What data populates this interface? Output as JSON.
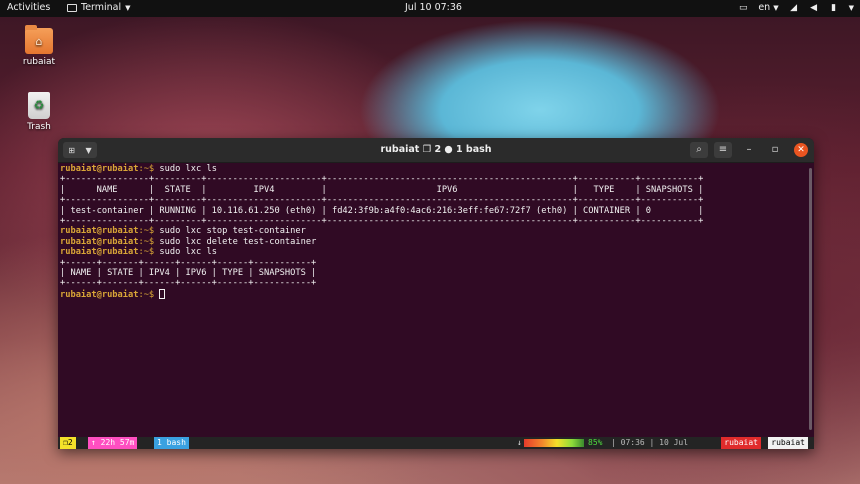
{
  "topbar": {
    "activities": "Activities",
    "app_name": "Terminal",
    "clock": "Jul 10  07:36",
    "lang": "en"
  },
  "desktop": {
    "icons": [
      {
        "label": "rubaiat"
      },
      {
        "label": "Trash"
      }
    ]
  },
  "window": {
    "title": "rubaiat ❐ 2 ● 1 bash"
  },
  "terminal": {
    "prompt_user": "rubaiat@rubaiat",
    "prompt_path": ":~$ ",
    "lines": [
      {
        "type": "prompt",
        "cmd": "sudo lxc ls"
      },
      {
        "type": "out",
        "text": "+----------------+---------+----------------------+-----------------------------------------------+-----------+-----------+"
      },
      {
        "type": "out",
        "text": "|      NAME      |  STATE  |         IPV4         |                     IPV6                      |   TYPE    | SNAPSHOTS |"
      },
      {
        "type": "out",
        "text": "+----------------+---------+----------------------+-----------------------------------------------+-----------+-----------+"
      },
      {
        "type": "out",
        "text": "| test-container | RUNNING | 10.116.61.250 (eth0) | fd42:3f9b:a4f0:4ac6:216:3eff:fe67:72f7 (eth0) | CONTAINER | 0         |"
      },
      {
        "type": "out",
        "text": "+----------------+---------+----------------------+-----------------------------------------------+-----------+-----------+"
      },
      {
        "type": "prompt",
        "cmd": "sudo lxc stop test-container"
      },
      {
        "type": "prompt",
        "cmd": "sudo lxc delete test-container"
      },
      {
        "type": "prompt",
        "cmd": "sudo lxc ls"
      },
      {
        "type": "out",
        "text": "+------+-------+------+------+------+-----------+"
      },
      {
        "type": "out",
        "text": "| NAME | STATE | IPV4 | IPV6 | TYPE | SNAPSHOTS |"
      },
      {
        "type": "out",
        "text": "+------+-------+------+------+------+-----------+"
      },
      {
        "type": "prompt",
        "cmd": ""
      }
    ]
  },
  "status": {
    "window_count": "2",
    "uptime": "↑ 22h 57m",
    "tab": "1 bash",
    "arrow": "↓",
    "battery_pct": "85%",
    "battery_level": 0.85,
    "time_date": "| 07:36 | 10 Jul",
    "user1": "rubaiat",
    "user2": "rubaiat"
  },
  "colors": {
    "terminal_bg": "#300a24",
    "prompt": "#d9a637",
    "close_button": "#e95420"
  }
}
